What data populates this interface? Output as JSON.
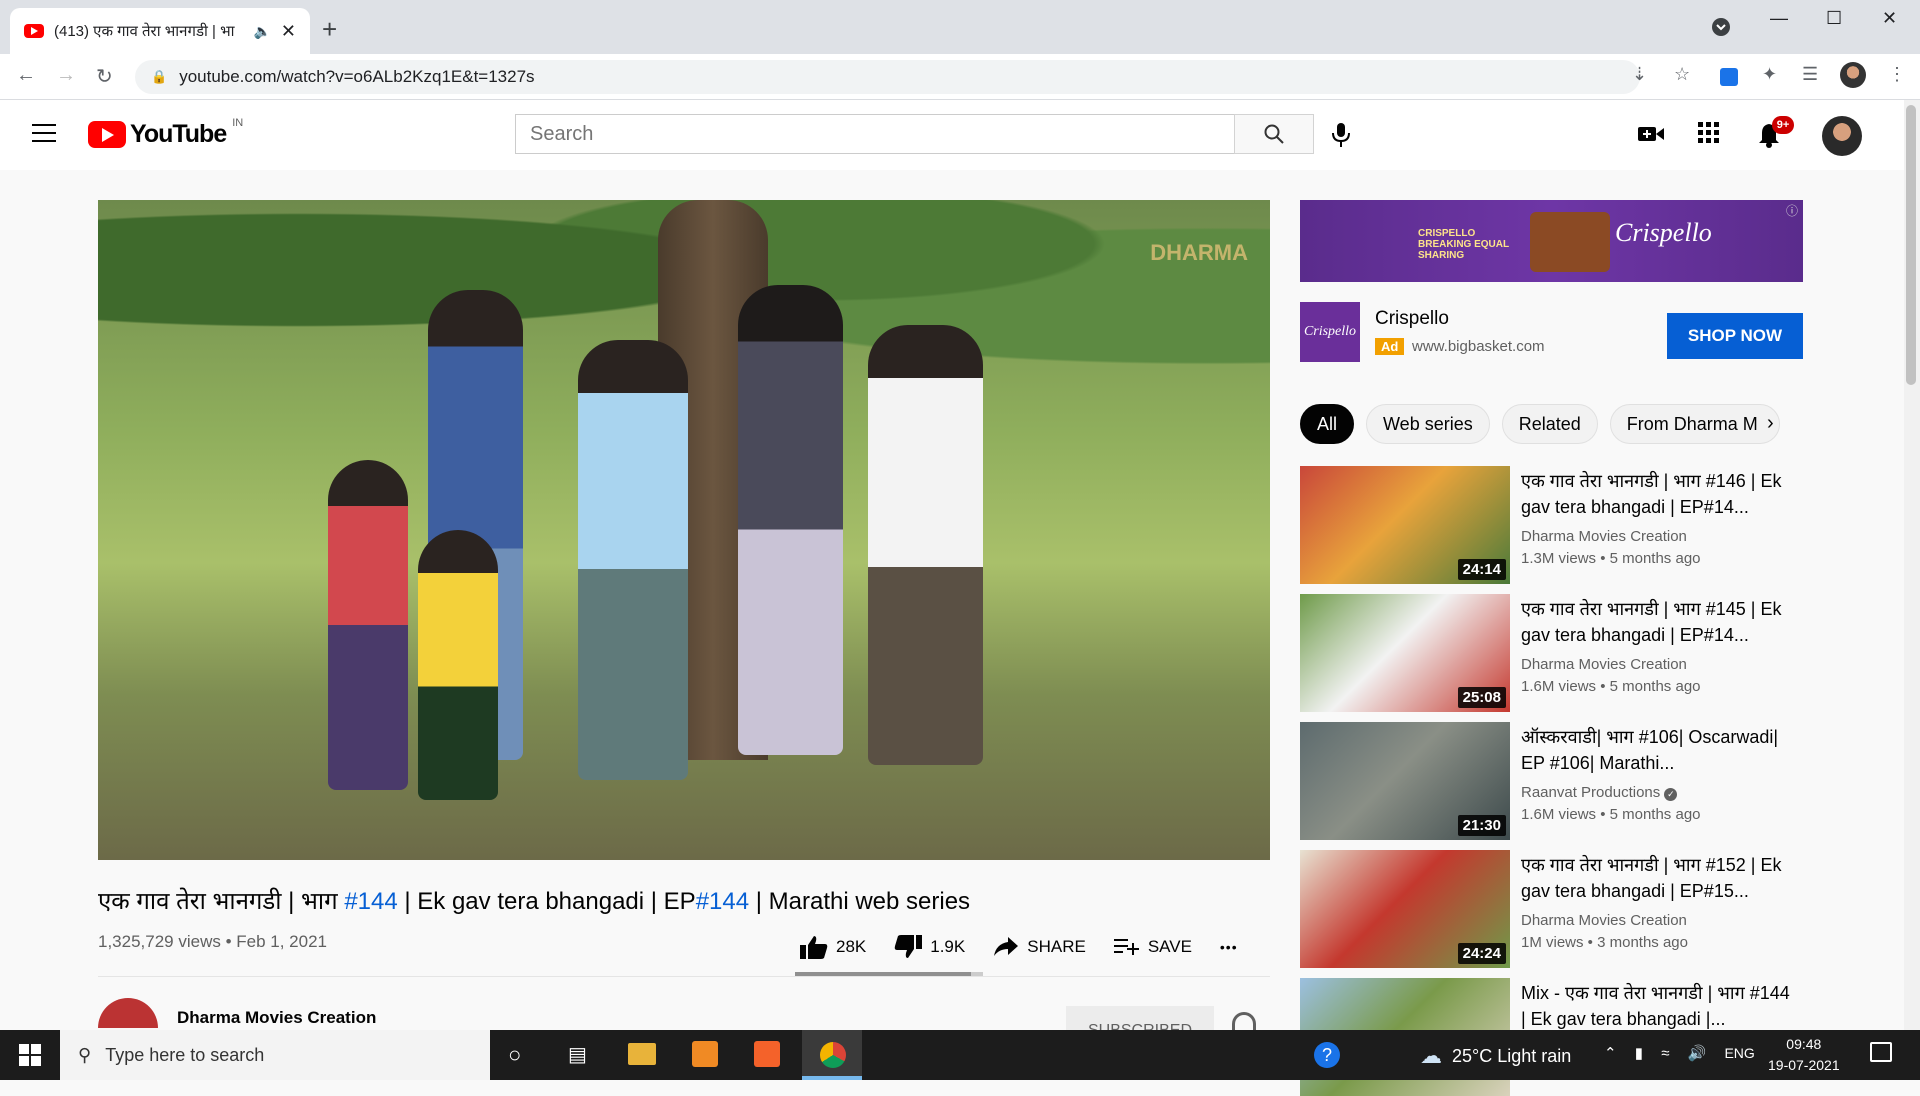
{
  "browser": {
    "tab_title": "(413) एक गाव तेरा भानगडी | भा",
    "new_tab_label": "+",
    "url": "youtube.com/watch?v=o6ALb2Kzq1E&t=1327s"
  },
  "masthead": {
    "logo_text": "YouTube",
    "country_code": "IN",
    "search_placeholder": "Search",
    "notification_badge": "9+"
  },
  "video": {
    "title_parts": [
      "एक गाव तेरा भानगडी | भाग ",
      "#144",
      " | Ek gav tera bhangadi | EP",
      "#144",
      " | Marathi web series"
    ],
    "meta": "1,325,729 views • Feb 1, 2021",
    "watermark": "DHARMA",
    "likes": "28K",
    "dislikes": "1.9K",
    "like_ratio": 0.936,
    "share_label": "SHARE",
    "save_label": "SAVE",
    "more_label": "•••",
    "channel_name": "Dharma Movies Creation",
    "subscribe_label": "SUBSCRIBED"
  },
  "ad": {
    "banner_tagline": "CRISPELLO BREAKING EQUAL SHARING",
    "banner_brand": "Crispello",
    "logo_text": "Crispello",
    "name": "Crispello",
    "badge": "Ad",
    "url": "www.bigbasket.com",
    "cta": "SHOP NOW"
  },
  "chips": [
    "All",
    "Web series",
    "Related",
    "From Dharma M"
  ],
  "recommendations": [
    {
      "title": "एक गाव तेरा भानगडी | भाग #146 | Ek gav tera bhangadi | EP#14...",
      "channel": "Dharma Movies Creation",
      "verified": false,
      "meta": "1.3M views • 5 months ago",
      "duration": "24:14",
      "colors": [
        "#c9473a",
        "#e8a33b",
        "#4a7a3a"
      ]
    },
    {
      "title": "एक गाव तेरा भानगडी | भाग #145 | Ek gav tera bhangadi | EP#14...",
      "channel": "Dharma Movies Creation",
      "verified": false,
      "meta": "1.6M views • 5 months ago",
      "duration": "25:08",
      "colors": [
        "#6f9b4a",
        "#f2f2f2",
        "#c4382e"
      ]
    },
    {
      "title": "ऑस्करवाडी| भाग #106| Oscarwadi| EP #106| Marathi...",
      "channel": "Raanvat Productions",
      "verified": true,
      "meta": "1.6M views • 5 months ago",
      "duration": "21:30",
      "colors": [
        "#5d6b6e",
        "#8a8f86",
        "#3d4a4c"
      ]
    },
    {
      "title": "एक गाव तेरा भानगडी | भाग #152 | Ek gav tera bhangadi | EP#15...",
      "channel": "Dharma Movies Creation",
      "verified": false,
      "meta": "1M views • 3 months ago",
      "duration": "24:24",
      "colors": [
        "#e8e2d2",
        "#c4382e",
        "#6f9b4a"
      ]
    },
    {
      "title": "Mix - एक गाव तेरा भानगडी | भाग #144 | Ek gav tera bhangadi |...",
      "channel": "",
      "verified": false,
      "meta": "",
      "duration": "",
      "colors": [
        "#9cc0e0",
        "#7a9a4a",
        "#d9d2bc"
      ]
    }
  ],
  "taskbar": {
    "search_placeholder": "Type here to search",
    "weather": "25°C  Light rain",
    "language": "ENG",
    "time": "09:48",
    "date": "19-07-2021"
  }
}
